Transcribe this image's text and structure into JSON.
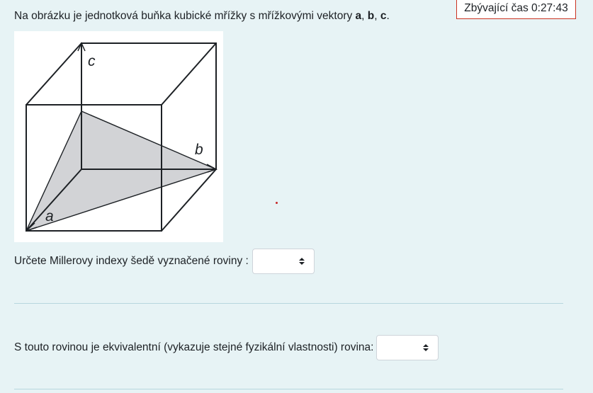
{
  "timer": {
    "label": "Zbývající čas 0:27:43"
  },
  "intro": {
    "prefix": "Na obrázku je jednotková buňka kubické mřížky s mřížkovými vektory ",
    "vec_a": "a",
    "sep1": ", ",
    "vec_b": "b",
    "sep2": ", ",
    "vec_c": "c",
    "suffix": "."
  },
  "figure": {
    "label_a": "a",
    "label_b": "b",
    "label_c": "c"
  },
  "question1": {
    "label": "Určete Millerovy indexy šedě vyznačené roviny :",
    "selected": ""
  },
  "question2": {
    "label": "S touto rovinou je ekvivalentní (vykazuje stejné fyzikální vlastnosti) rovina:",
    "selected": ""
  },
  "colors": {
    "background": "#e7f3f5",
    "plane": "#d2d3d6",
    "timer_border": "#ca3120"
  }
}
